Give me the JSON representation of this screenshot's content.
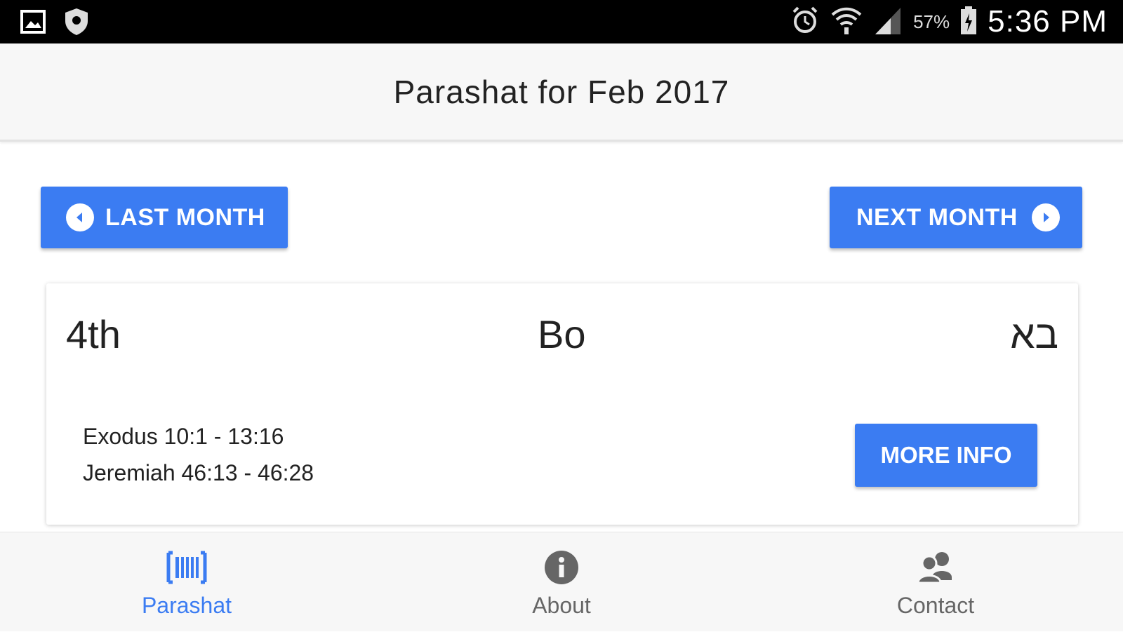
{
  "status_bar": {
    "battery_percent": "57%",
    "time": "5:36 PM",
    "icons": [
      "gallery-icon",
      "shield-icon",
      "alarm-icon",
      "wifi-icon",
      "signal-icon",
      "battery-icon"
    ]
  },
  "app_bar": {
    "title": "Parashat for Feb 2017"
  },
  "controls": {
    "last_month_label": "LAST MONTH",
    "next_month_label": "NEXT MONTH"
  },
  "parasha_card": {
    "date": "4th",
    "name": "Bo",
    "hebrew_name": "בא",
    "readings": [
      "Exodus 10:1 - 13:16",
      "Jeremiah 46:13 - 46:28"
    ],
    "more_info_label": "MORE INFO"
  },
  "bottom_nav": {
    "items": [
      {
        "label": "Parashat",
        "icon": "torah-scroll-icon",
        "active": true
      },
      {
        "label": "About",
        "icon": "info-icon",
        "active": false
      },
      {
        "label": "Contact",
        "icon": "people-icon",
        "active": false
      }
    ]
  },
  "colors": {
    "accent": "#3b7cf2",
    "status_bar": "#000000",
    "app_bar": "#f7f7f7"
  }
}
